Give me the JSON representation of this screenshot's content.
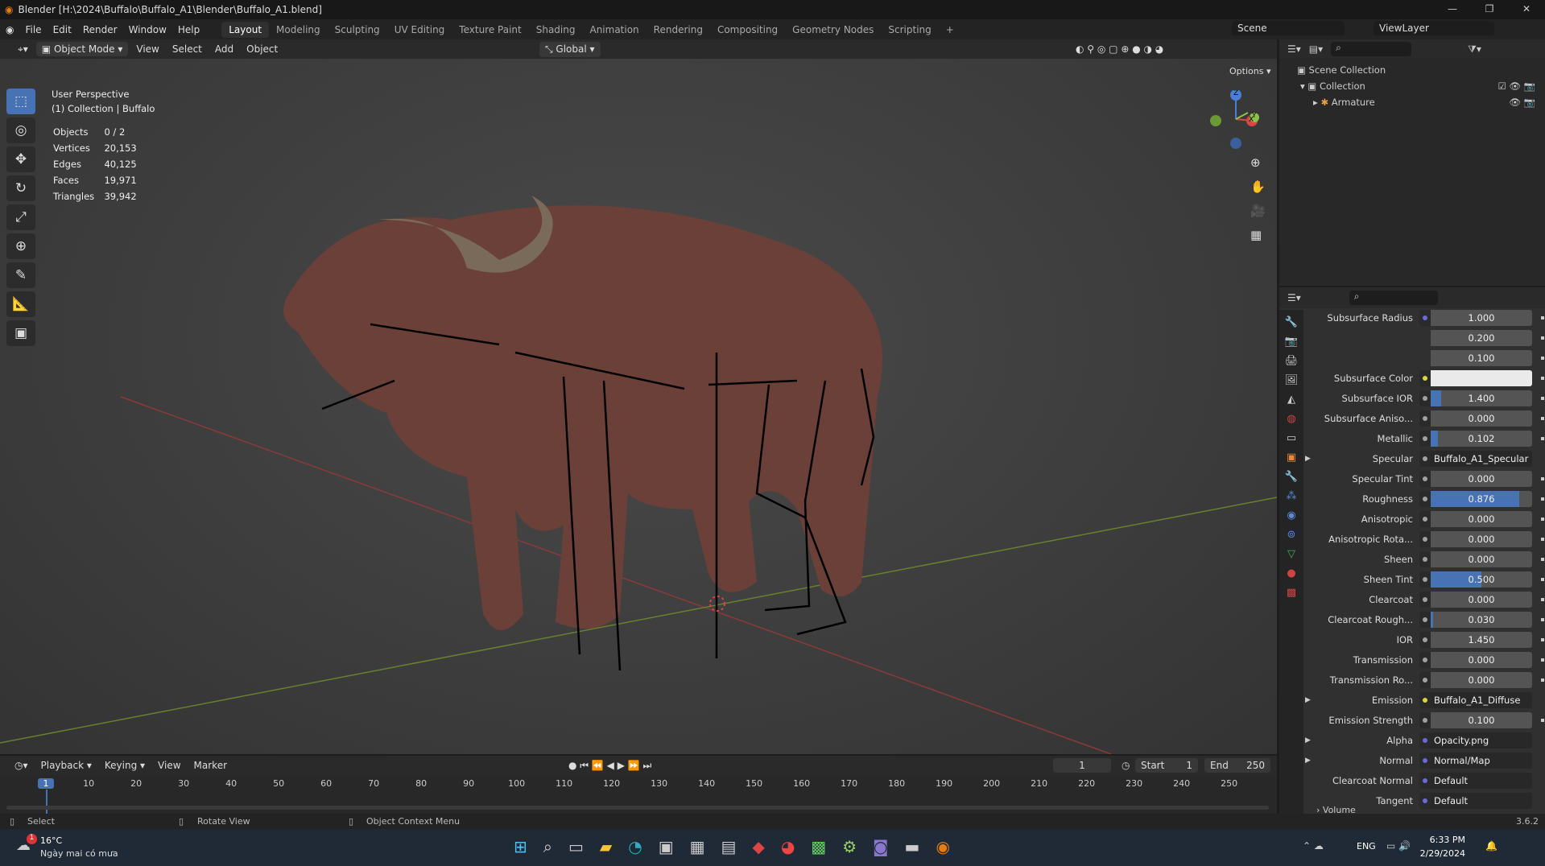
{
  "title": "Blender [H:\\2024\\Buffalo\\Buffalo_A1\\Blender\\Buffalo_A1.blend]",
  "menu": [
    "File",
    "Edit",
    "Render",
    "Window",
    "Help"
  ],
  "workspaces": [
    "Layout",
    "Modeling",
    "Sculpting",
    "UV Editing",
    "Texture Paint",
    "Shading",
    "Animation",
    "Rendering",
    "Compositing",
    "Geometry Nodes",
    "Scripting"
  ],
  "scene": "Scene",
  "view_layer": "ViewLayer",
  "header": {
    "mode": "Object Mode",
    "view": "View",
    "select": "Select",
    "add": "Add",
    "object": "Object",
    "orientation": "Global",
    "options": "Options"
  },
  "viewport": {
    "perspective": "User Perspective",
    "collection": "(1) Collection | Buffalo",
    "stats": [
      {
        "k": "Objects",
        "v": "0 / 2"
      },
      {
        "k": "Vertices",
        "v": "20,153"
      },
      {
        "k": "Edges",
        "v": "40,125"
      },
      {
        "k": "Faces",
        "v": "19,971"
      },
      {
        "k": "Triangles",
        "v": "39,942"
      }
    ],
    "gizmo": {
      "z": "Z",
      "y": "Y",
      "x": "X"
    }
  },
  "outliner": {
    "scene_collection": "Scene Collection",
    "collection": "Collection",
    "armature": "Armature"
  },
  "props": {
    "rows": [
      {
        "label": "Subsurface Radius",
        "value": "1.000",
        "fill": 0,
        "dot": "#6a6ad8"
      },
      {
        "label": "",
        "value": "0.200",
        "fill": 0
      },
      {
        "label": "",
        "value": "0.100",
        "fill": 0
      },
      {
        "label": "Subsurface Color",
        "value": "",
        "type": "color",
        "dot": "#d8d83a"
      },
      {
        "label": "Subsurface IOR",
        "value": "1.400",
        "fill": 0.1
      },
      {
        "label": "Subsurface Aniso...",
        "value": "0.000",
        "fill": 0
      },
      {
        "label": "Metallic",
        "value": "0.102",
        "fill": 0.07
      },
      {
        "label": "Specular",
        "value": "Buffalo_A1_Specular",
        "type": "link",
        "arrow": true
      },
      {
        "label": "Specular Tint",
        "value": "0.000",
        "fill": 0
      },
      {
        "label": "Roughness",
        "value": "0.876",
        "fill": 0.876
      },
      {
        "label": "Anisotropic",
        "value": "0.000",
        "fill": 0
      },
      {
        "label": "Anisotropic Rota...",
        "value": "0.000",
        "fill": 0
      },
      {
        "label": "Sheen",
        "value": "0.000",
        "fill": 0
      },
      {
        "label": "Sheen Tint",
        "value": "0.500",
        "fill": 0.5
      },
      {
        "label": "Clearcoat",
        "value": "0.000",
        "fill": 0
      },
      {
        "label": "Clearcoat Rough...",
        "value": "0.030",
        "fill": 0.02
      },
      {
        "label": "IOR",
        "value": "1.450",
        "fill": 0
      },
      {
        "label": "Transmission",
        "value": "0.000",
        "fill": 0
      },
      {
        "label": "Transmission Ro...",
        "value": "0.000",
        "fill": 0
      },
      {
        "label": "Emission",
        "value": "Buffalo_A1_Diffuse",
        "type": "link",
        "arrow": true,
        "dot": "#d8d83a"
      },
      {
        "label": "Emission Strength",
        "value": "0.100",
        "fill": 0
      },
      {
        "label": "Alpha",
        "value": "Opacity.png",
        "type": "link",
        "arrow": true,
        "dot": "#6a6ad8"
      },
      {
        "label": "Normal",
        "value": "Normal/Map",
        "type": "link",
        "arrow": true,
        "dot": "#6a6ad8"
      },
      {
        "label": "Clearcoat Normal",
        "value": "Default",
        "type": "link",
        "dot": "#6a6ad8"
      },
      {
        "label": "Tangent",
        "value": "Default",
        "type": "link",
        "dot": "#6a6ad8"
      }
    ],
    "volume": "Volume"
  },
  "timeline": {
    "playback": "Playback",
    "keying": "Keying",
    "view": "View",
    "marker": "Marker",
    "current": "1",
    "start_label": "Start",
    "start": "1",
    "end_label": "End",
    "end": "250",
    "ticks": [
      "1",
      "10",
      "20",
      "30",
      "40",
      "50",
      "60",
      "70",
      "80",
      "90",
      "100",
      "110",
      "120",
      "130",
      "140",
      "150",
      "160",
      "170",
      "180",
      "190",
      "200",
      "210",
      "220",
      "230",
      "240",
      "250"
    ]
  },
  "status": {
    "select": "Select",
    "rotate": "Rotate View",
    "context": "Object Context Menu",
    "version": "3.6.2"
  },
  "taskbar": {
    "temp": "16°C",
    "weather": "Ngày mai có mưa",
    "lang": "ENG",
    "time": "6:33 PM",
    "date": "2/29/2024",
    "badge": "1"
  }
}
